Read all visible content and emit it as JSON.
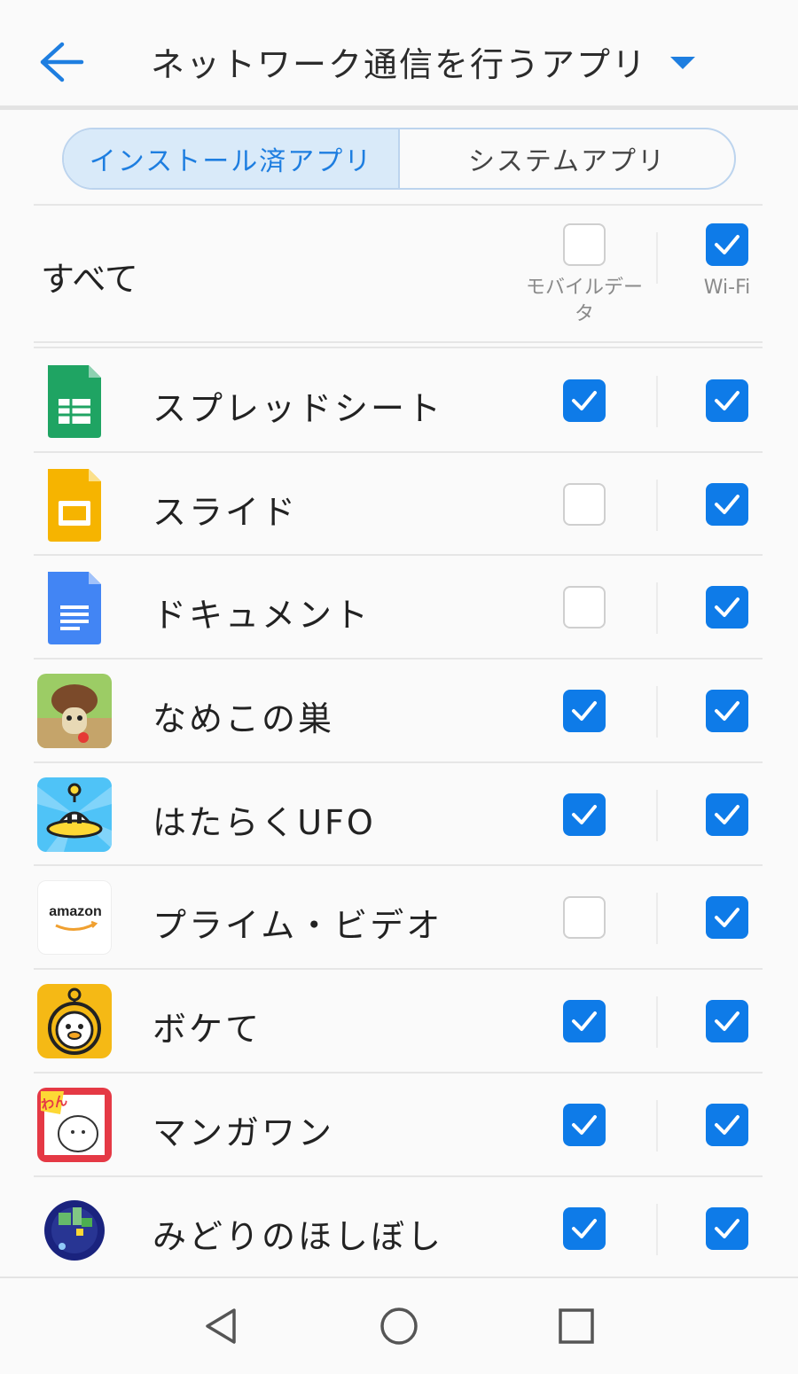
{
  "header": {
    "title": "ネットワーク通信を行うアプリ",
    "back_icon": "arrow-left-icon",
    "dropdown_icon": "triangle-down-icon",
    "accent": "#1e7ee0"
  },
  "tabs": [
    {
      "label": "インストール済アプリ",
      "active": true
    },
    {
      "label": "システムアプリ",
      "active": false
    }
  ],
  "all_row": {
    "label": "すべて",
    "mobile_label_line1": "モバイルデー",
    "mobile_label_line2": "タ",
    "wifi_label": "Wi-Fi",
    "mobile_checked": false,
    "wifi_checked": true
  },
  "apps": [
    {
      "name": "スプレッドシート",
      "icon": "sheets-icon",
      "mobile": true,
      "wifi": true
    },
    {
      "name": "スライド",
      "icon": "slides-icon",
      "mobile": false,
      "wifi": true
    },
    {
      "name": "ドキュメント",
      "icon": "docs-icon",
      "mobile": false,
      "wifi": true
    },
    {
      "name": "なめこの巣",
      "icon": "nameko-icon",
      "mobile": true,
      "wifi": true
    },
    {
      "name": "はたらくUFO",
      "icon": "ufo-icon",
      "mobile": true,
      "wifi": true
    },
    {
      "name": "プライム・ビデオ",
      "icon": "amazon-icon",
      "icon_text": "amazon",
      "mobile": false,
      "wifi": true
    },
    {
      "name": "ボケて",
      "icon": "bokete-icon",
      "mobile": true,
      "wifi": true
    },
    {
      "name": "マンガワン",
      "icon": "mangaone-icon",
      "icon_text": "わん",
      "mobile": true,
      "wifi": true
    },
    {
      "name": "みどりのほしぼし",
      "icon": "midori-icon",
      "mobile": true,
      "wifi": true
    }
  ],
  "navbar": {
    "back": "nav-back-icon",
    "home": "nav-home-icon",
    "recents": "nav-recents-icon"
  },
  "colors": {
    "checked": "#0e7be8",
    "unchecked_border": "#cfcfcf"
  }
}
